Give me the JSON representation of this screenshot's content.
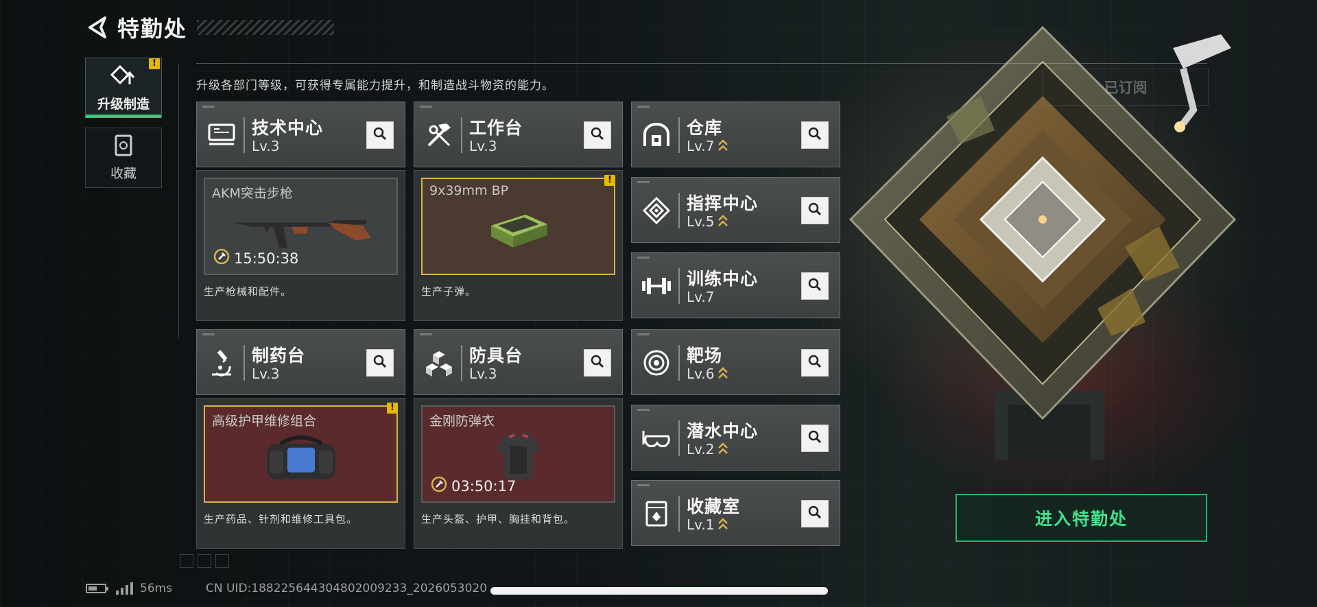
{
  "header": {
    "title": "特勤处"
  },
  "description": "升级各部门等级，可获得专属能力提升，和制造战斗物资的能力。",
  "side_nav": [
    {
      "label": "升级制造",
      "icon": "upgrade-craft-icon",
      "active": true,
      "alert": "!"
    },
    {
      "label": "收藏",
      "icon": "collection-icon",
      "active": false
    }
  ],
  "departments": [
    {
      "id": "tech-center",
      "name": "技术中心",
      "level": "Lv.3",
      "icon": "tech-center-icon"
    },
    {
      "id": "workbench",
      "name": "工作台",
      "level": "Lv.3",
      "icon": "hammer-wrench-icon"
    },
    {
      "id": "warehouse",
      "name": "仓库",
      "level": "Lv.7",
      "icon": "warehouse-icon"
    },
    {
      "id": "command-center",
      "name": "指挥中心",
      "level": "Lv.5",
      "icon": "command-center-icon"
    },
    {
      "id": "training-center",
      "name": "训练中心",
      "level": "Lv.7",
      "icon": "dumbbell-icon"
    },
    {
      "id": "pharmacy",
      "name": "制药台",
      "level": "Lv.3",
      "icon": "microscope-icon"
    },
    {
      "id": "armor-bench",
      "name": "防具台",
      "level": "Lv.3",
      "icon": "cubes-icon"
    },
    {
      "id": "shooting-range",
      "name": "靶场",
      "level": "Lv.6",
      "icon": "target-icon"
    },
    {
      "id": "diving-center",
      "name": "潜水中心",
      "level": "Lv.2",
      "icon": "diving-mask-icon"
    },
    {
      "id": "collection-room",
      "name": "收藏室",
      "level": "Lv.1",
      "icon": "collection-room-icon"
    }
  ],
  "production": [
    {
      "dept": "tech-center",
      "item": "AKM突击步枪",
      "timer": "15:50:38",
      "caption": "生产枪械和配件。",
      "state": "in-progress"
    },
    {
      "dept": "workbench",
      "item": "9x39mm BP",
      "timer": "",
      "caption": "生产子弹。",
      "state": "ready",
      "alert": "!"
    },
    {
      "dept": "pharmacy",
      "item": "高级护甲维修组合",
      "timer": "",
      "caption": "生产药品、针剂和维修工具包。",
      "state": "ready",
      "alert": "!"
    },
    {
      "dept": "armor-bench",
      "item": "金刚防弹衣",
      "timer": "03:50:17",
      "caption": "生产头盔、护甲、胸挂和背包。",
      "state": "in-progress"
    }
  ],
  "subscribe_label": "已订阅",
  "enter_button": "进入特勤处",
  "status_bar": {
    "ping": "56ms",
    "uid": "CN UID:188225644304802009233_2026053020"
  },
  "colors": {
    "accent_green": "#2fcf7e",
    "alert_yellow": "#e6b800",
    "upgrade_chevron": "#d8b24a"
  }
}
